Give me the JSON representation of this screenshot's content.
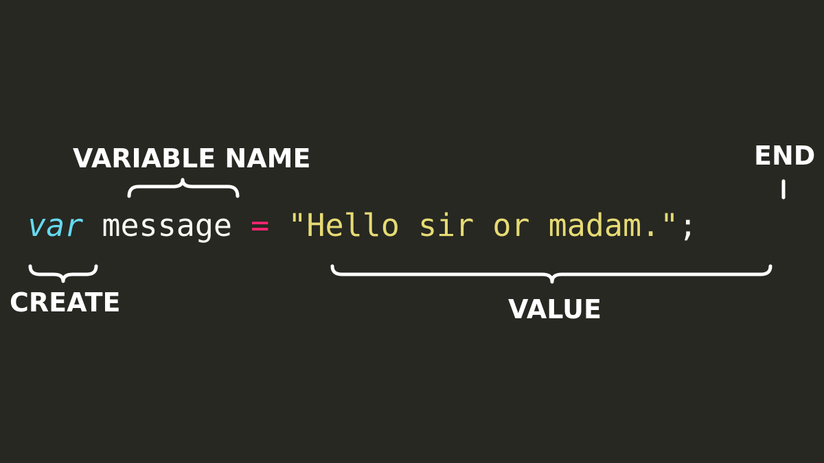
{
  "labels": {
    "variable_name": "VARIABLE NAME",
    "end": "END",
    "create": "CREATE",
    "value": "VALUE"
  },
  "code": {
    "keyword": "var",
    "space1": " ",
    "identifier": "message",
    "space2": " ",
    "operator": "=",
    "space3": " ",
    "string": "\"Hello sir or madam.\"",
    "terminator": ";"
  },
  "colors": {
    "background": "#272822",
    "keyword": "#66d9ef",
    "identifier": "#f8f8f2",
    "operator": "#f92672",
    "string": "#e6db74",
    "terminator": "#f8f8f2",
    "labels": "#ffffff"
  }
}
